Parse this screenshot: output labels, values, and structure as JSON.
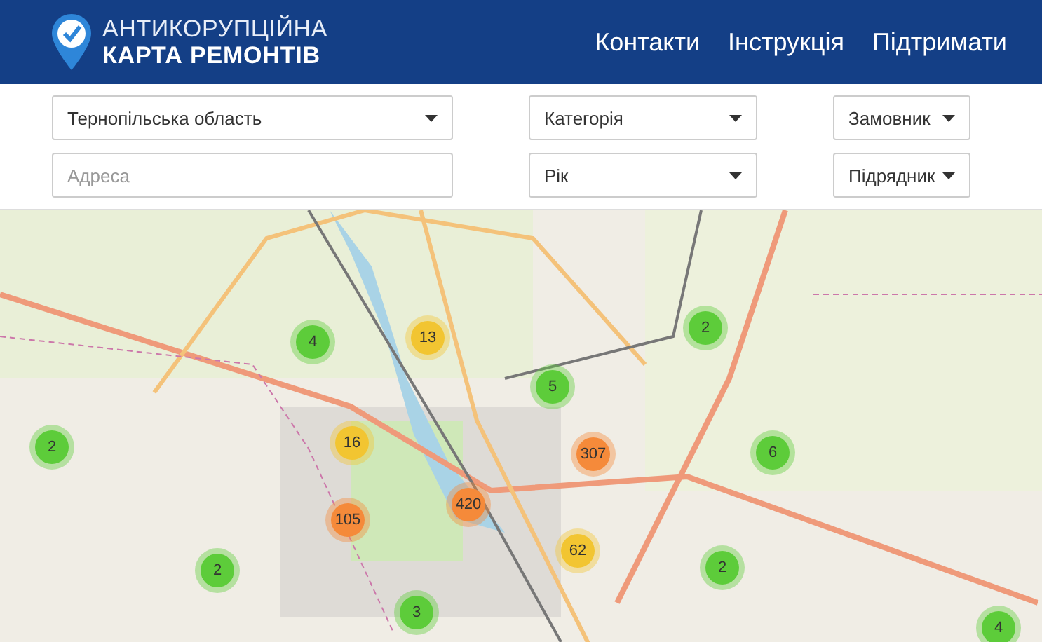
{
  "header": {
    "logo": {
      "line1": "АНТИКОРУПЦІЙНА",
      "line2": "КАРТА РЕМОНТІВ"
    },
    "nav": [
      "Контакти",
      "Інструкція",
      "Підтримати"
    ]
  },
  "filters": [
    {
      "kind": "select",
      "value": "Тернопільська область"
    },
    {
      "kind": "select",
      "value": "Категорія"
    },
    {
      "kind": "select",
      "value": "Замовник"
    },
    {
      "kind": "input",
      "placeholder": "Адреса"
    },
    {
      "kind": "select",
      "value": "Рік"
    },
    {
      "kind": "select",
      "value": "Підрядник"
    }
  ],
  "map": {
    "clusters": [
      {
        "count": "13",
        "color": "#f2c531"
      },
      {
        "count": "2",
        "color": "#5dcc3a"
      },
      {
        "count": "4",
        "color": "#5dcc3a"
      },
      {
        "count": "5",
        "color": "#5dcc3a"
      },
      {
        "count": "2",
        "color": "#5dcc3a"
      },
      {
        "count": "16",
        "color": "#f2c531"
      },
      {
        "count": "307",
        "color": "#f58a3a"
      },
      {
        "count": "6",
        "color": "#5dcc3a"
      },
      {
        "count": "420",
        "color": "#f58a3a"
      },
      {
        "count": "105",
        "color": "#f58a3a"
      },
      {
        "count": "62",
        "color": "#f2c531"
      },
      {
        "count": "2",
        "color": "#5dcc3a"
      },
      {
        "count": "2",
        "color": "#5dcc3a"
      },
      {
        "count": "3",
        "color": "#5dcc3a"
      },
      {
        "count": "4",
        "color": "#5dcc3a"
      }
    ]
  }
}
